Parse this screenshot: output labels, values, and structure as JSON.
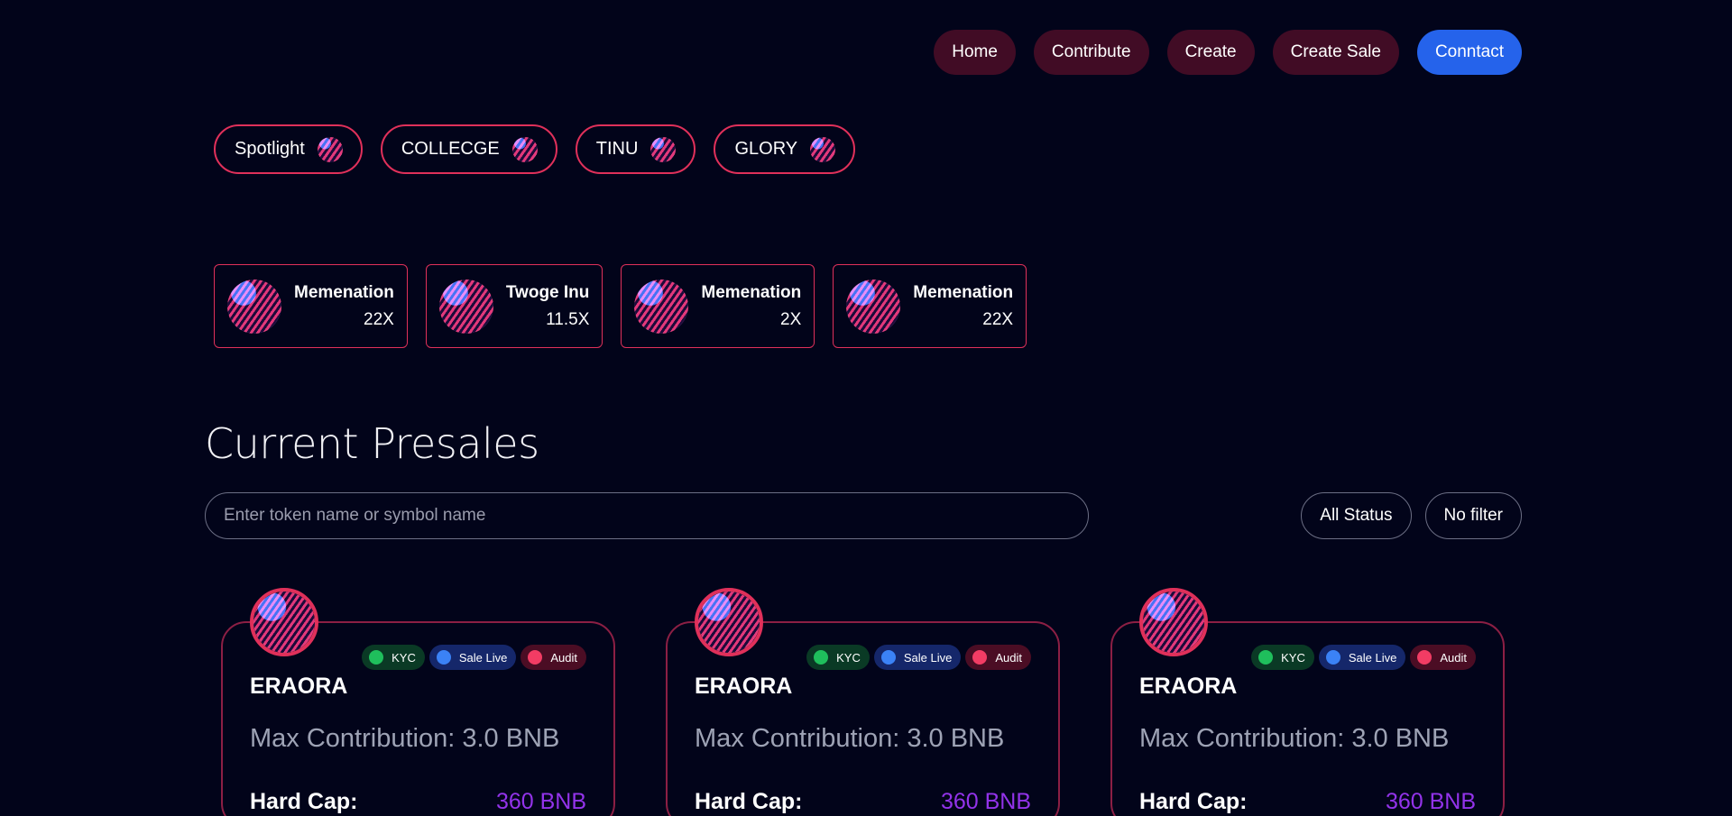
{
  "nav": {
    "items": [
      "Home",
      "Contribute",
      "Create",
      "Create Sale"
    ],
    "contact": "Conntact"
  },
  "tags": [
    "Spotlight",
    "COLLECGE",
    "TINU",
    "GLORY"
  ],
  "trending": [
    {
      "name": "Memenation",
      "multiplier": "22X"
    },
    {
      "name": "Twoge Inu",
      "multiplier": "11.5X"
    },
    {
      "name": "Memenation",
      "multiplier": "2X"
    },
    {
      "name": "Memenation",
      "multiplier": "22X"
    }
  ],
  "presales": {
    "title": "Current Presales",
    "search_placeholder": "Enter token name or symbol name",
    "filters": {
      "status": "All Status",
      "filter": "No filter"
    },
    "cards": [
      {
        "name": "ERAORA",
        "badges": {
          "kyc": "KYC",
          "live": "Sale Live",
          "audit": "Audit"
        },
        "max_contribution": "Max Contribution: 3.0 BNB",
        "hard_cap_label": "Hard Cap:",
        "hard_cap_value": "360 BNB"
      },
      {
        "name": "ERAORA",
        "badges": {
          "kyc": "KYC",
          "live": "Sale Live",
          "audit": "Audit"
        },
        "max_contribution": "Max Contribution: 3.0 BNB",
        "hard_cap_label": "Hard Cap:",
        "hard_cap_value": "360 BNB"
      },
      {
        "name": "ERAORA",
        "badges": {
          "kyc": "KYC",
          "live": "Sale Live",
          "audit": "Audit"
        },
        "max_contribution": "Max Contribution: 3.0 BNB",
        "hard_cap_label": "Hard Cap:",
        "hard_cap_value": "360 BNB"
      }
    ]
  },
  "colors": {
    "background": "#02041a",
    "accent_pink": "#e0305a",
    "nav_button": "#410c25",
    "primary_blue": "#2563eb",
    "hard_cap_purple": "#9333ea"
  }
}
